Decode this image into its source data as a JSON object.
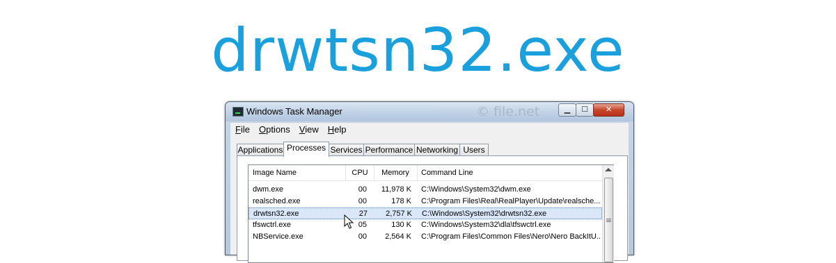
{
  "headline": "drwtsn32.exe",
  "window": {
    "title": "Windows Task Manager",
    "watermark": "© file.net",
    "controls": {
      "minimize": "▁",
      "maximize": "☐",
      "close": "✕"
    }
  },
  "menu": [
    "File",
    "Options",
    "View",
    "Help"
  ],
  "tabs": [
    "Applications",
    "Processes",
    "Services",
    "Performance",
    "Networking",
    "Users"
  ],
  "active_tab": "Processes",
  "table": {
    "columns": [
      "Image Name",
      "CPU",
      "Memory",
      "Command Line"
    ],
    "rows": [
      {
        "name": "dwm.exe",
        "cpu": "00",
        "memory": "11,978 K",
        "cmd": "C:\\Windows\\System32\\dwm.exe"
      },
      {
        "name": "realsched.exe",
        "cpu": "00",
        "memory": "178 K",
        "cmd": "C:\\Program Files\\Real\\RealPlayer\\Update\\realsche..."
      },
      {
        "name": "drwtsn32.exe",
        "cpu": "27",
        "memory": "2,757 K",
        "cmd": "C:\\Windows\\System32\\drwtsn32.exe"
      },
      {
        "name": "tfswctrl.exe",
        "cpu": "05",
        "memory": "130 K",
        "cmd": "C:\\Windows\\System32\\dla\\tfswctrl.exe"
      },
      {
        "name": "NBService.exe",
        "cpu": "00",
        "memory": "2,564 K",
        "cmd": "C:\\Program Files\\Common Files\\Nero\\Nero BackItU..."
      }
    ],
    "selected_row": 2
  },
  "colors": {
    "headline": "#1aa0dc",
    "selection": "#d9e7f9"
  }
}
